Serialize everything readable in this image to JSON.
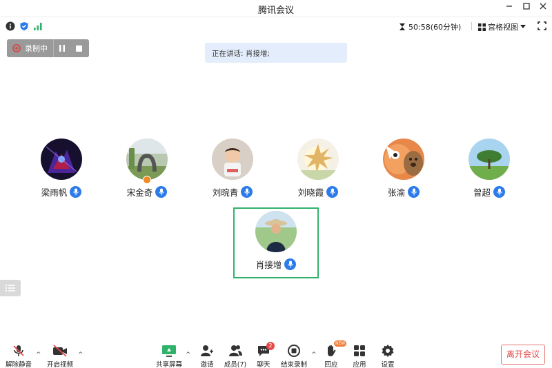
{
  "window": {
    "title": "腾讯会议"
  },
  "infobar": {
    "timer": "50:58(60分钟)",
    "view_label": "宫格视图"
  },
  "recording": {
    "label": "录制中"
  },
  "speaking": {
    "text": "正在讲话: 肖接增;"
  },
  "participants": [
    {
      "name": "梁雨帆"
    },
    {
      "name": "宋金奇"
    },
    {
      "name": "刘晥青"
    },
    {
      "name": "刘晓霞"
    },
    {
      "name": "张渝"
    },
    {
      "name": "曾超"
    },
    {
      "name": "肖接增"
    }
  ],
  "toolbar": {
    "unmute": "解除静音",
    "start_video": "开启视频",
    "share_screen": "共享屏幕",
    "invite": "邀请",
    "members": "成员(7)",
    "chat": "聊天",
    "chat_badge": "2",
    "end_recording": "结束录制",
    "reactions": "回应",
    "reactions_badge": "NEW",
    "apps": "应用",
    "settings": "设置",
    "leave": "离开会议"
  },
  "colors": {
    "accent_blue": "#2b7bea",
    "speaking_bg": "#e3edfb",
    "focus_border": "#2fb36a",
    "leave_red": "#e24a4a",
    "recording_bg": "#9a9a9a"
  }
}
